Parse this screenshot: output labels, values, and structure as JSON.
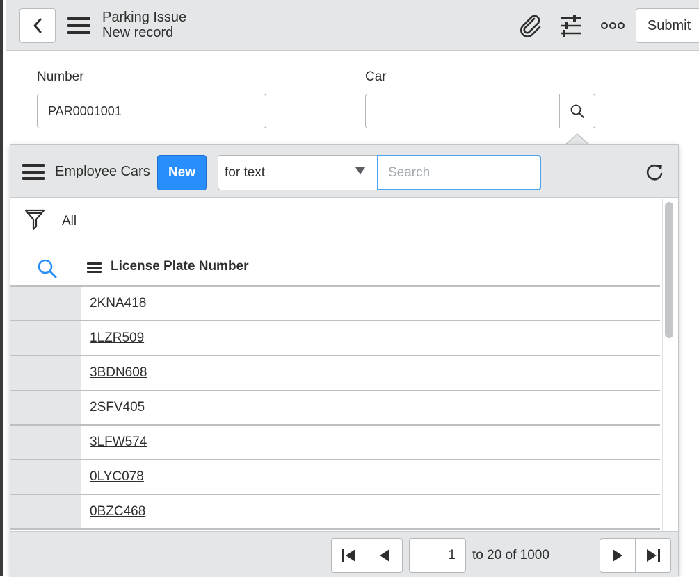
{
  "header": {
    "title": "Parking Issue",
    "subtitle": "New record",
    "submit_label": "Submit"
  },
  "form": {
    "number_label": "Number",
    "number_value": "PAR0001001",
    "car_label": "Car",
    "car_value": ""
  },
  "lookup": {
    "title": "Employee Cars",
    "new_label": "New",
    "search_field_selected": "for text",
    "search_placeholder": "Search",
    "filter_label": "All",
    "column_header": "License Plate Number",
    "rows": [
      "2KNA418",
      "1LZR509",
      "3BDN608",
      "2SFV405",
      "3LFW574",
      "0LYC078",
      "0BZC468"
    ],
    "pager": {
      "current_page": "1",
      "range_text": "to 20 of 1000"
    }
  },
  "colors": {
    "accent": "#278efc",
    "header_bg": "#e4e6e7",
    "search_focus": "#4aa3f4"
  }
}
